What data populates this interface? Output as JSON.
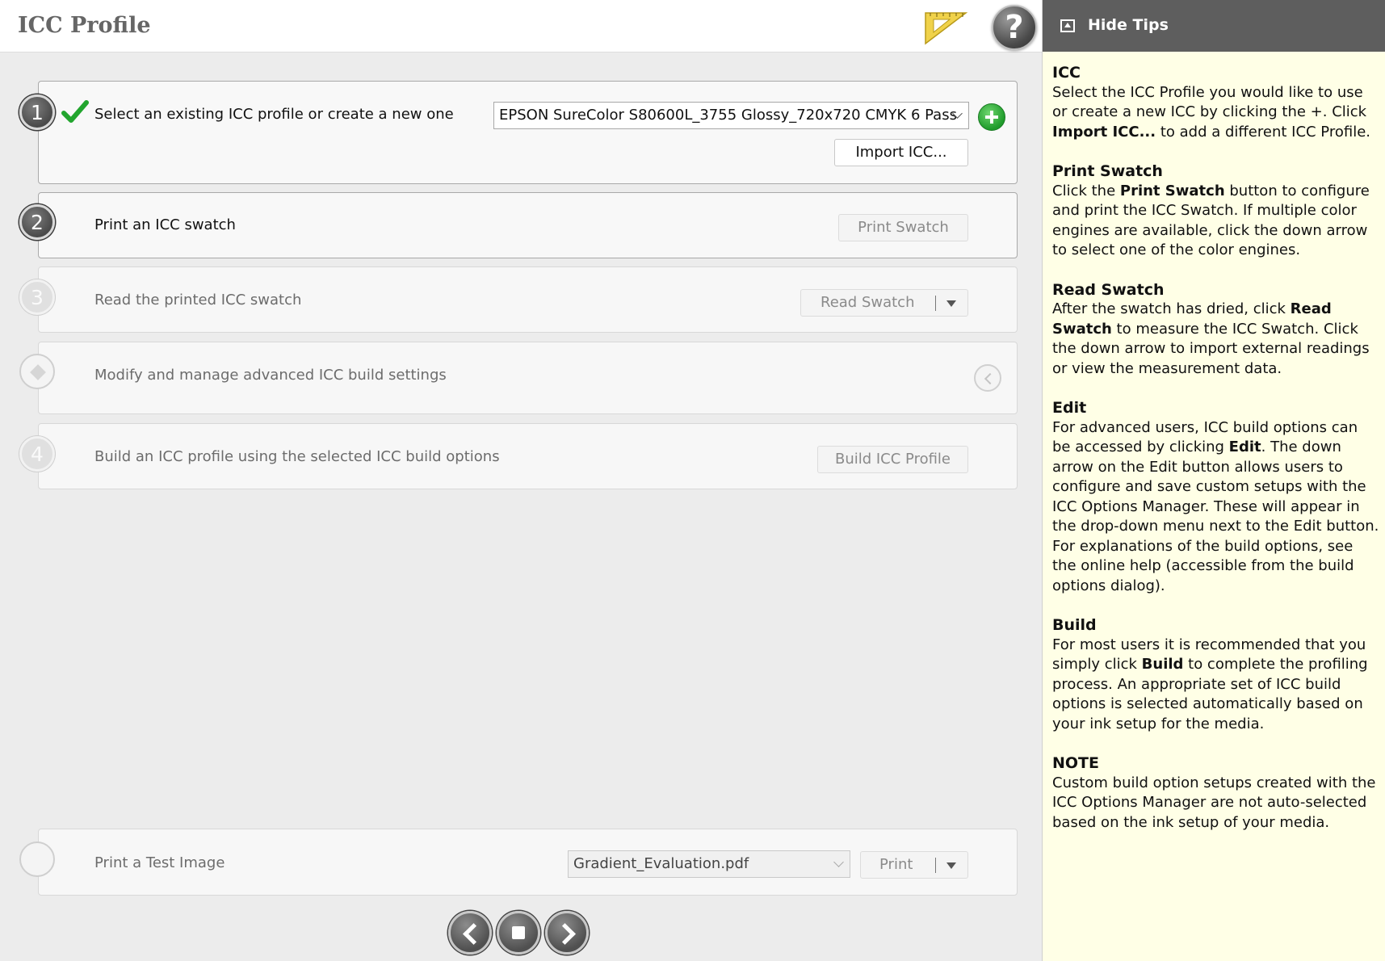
{
  "header": {
    "title": "ICC Profile"
  },
  "steps": {
    "s1": {
      "number": "1",
      "label": "Select an existing ICC profile or create a new one",
      "profile_value": "EPSON SureColor S80600L_3755 Glossy_720x720 CMYK 6 Pass",
      "import_label": "Import ICC..."
    },
    "s2": {
      "number": "2",
      "label": "Print an ICC swatch",
      "button": "Print Swatch"
    },
    "s3": {
      "number": "3",
      "label": "Read the printed ICC swatch",
      "button": "Read Swatch"
    },
    "s_edit": {
      "label": "Modify and manage advanced ICC build settings"
    },
    "s4": {
      "number": "4",
      "label": "Build an ICC profile using the selected ICC build options",
      "button": "Build ICC Profile"
    },
    "test": {
      "label": "Print a Test Image",
      "file_value": "Gradient_Evaluation.pdf",
      "button": "Print"
    }
  },
  "tips": {
    "hide_label": "Hide Tips",
    "icc": {
      "title": "ICC",
      "t1": "Select the ICC Profile you would like to use or create a new ICC by clicking the +. Click ",
      "b1": "Import ICC...",
      "t2": " to add a different ICC Profile."
    },
    "print_swatch": {
      "title": "Print Swatch",
      "t1": "Click the ",
      "b1": "Print Swatch",
      "t2": " button to configure and print the ICC Swatch. If multiple color engines are available, click the down arrow to select one of the color engines."
    },
    "read_swatch": {
      "title": "Read Swatch",
      "t1": "After the swatch has dried, click ",
      "b1": "Read Swatch",
      "t2": " to measure the ICC Swatch. Click the down arrow to import external readings or view the measurement data."
    },
    "edit": {
      "title": "Edit",
      "t1": "For advanced users, ICC build options can be accessed by clicking ",
      "b1": "Edit",
      "t2": ". The down arrow on the Edit button allows users to configure and save custom setups with the ICC Options Manager. These will appear in the drop-down menu next to the Edit button. For explanations of the build options, see the online help (accessible from the build options dialog)."
    },
    "build": {
      "title": "Build",
      "t1": "For most users it is recommended that you simply click ",
      "b1": "Build",
      "t2": " to complete the profiling process. An appropriate set of ICC build options is selected automatically based on your ink setup for the media."
    },
    "note": {
      "title": "NOTE",
      "t1": "Custom build option setups created with the ICC Options Manager are not auto-selected based on the ink setup of your media."
    }
  },
  "icons": {
    "ruler": "ruler-triangle-icon",
    "help": "help-icon",
    "check": "checkmark-icon",
    "plus": "add-icon",
    "back": "chevron-left-icon",
    "hide": "collapse-icon"
  },
  "colors": {
    "accent_green": "#1f9b2b",
    "tips_bg": "#ffffe6",
    "tips_header": "#5e5e5e",
    "ruler_yellow": "#f0d24a"
  }
}
